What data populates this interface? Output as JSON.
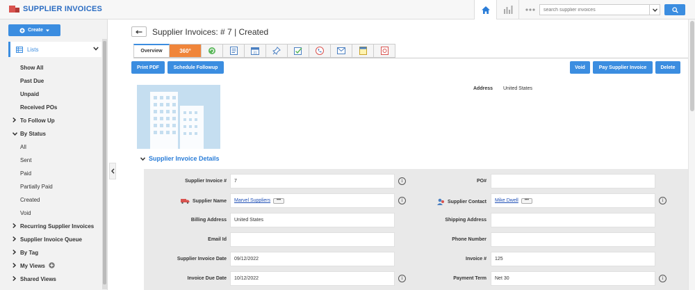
{
  "app": {
    "title": "SUPPLIER INVOICES"
  },
  "search": {
    "placeholder": "search supplier invoices"
  },
  "sidebar": {
    "create_label": "Create",
    "lists_label": "Lists",
    "items": [
      {
        "label": "Show All",
        "bold": true,
        "kind": "top"
      },
      {
        "label": "Past Due",
        "bold": true,
        "kind": "top"
      },
      {
        "label": "Unpaid",
        "bold": true,
        "kind": "top"
      },
      {
        "label": "Received POs",
        "bold": true,
        "kind": "top"
      },
      {
        "label": "To Follow Up",
        "bold": true,
        "kind": "collapsed"
      },
      {
        "label": "By Status",
        "bold": true,
        "kind": "expanded"
      },
      {
        "label": "All",
        "bold": false,
        "kind": "sub"
      },
      {
        "label": "Sent",
        "bold": false,
        "kind": "sub"
      },
      {
        "label": "Paid",
        "bold": false,
        "kind": "sub"
      },
      {
        "label": "Partially Paid",
        "bold": false,
        "kind": "sub"
      },
      {
        "label": "Created",
        "bold": false,
        "kind": "sub"
      },
      {
        "label": "Void",
        "bold": false,
        "kind": "sub"
      },
      {
        "label": "Recurring Supplier Invoices",
        "bold": true,
        "kind": "collapsed"
      },
      {
        "label": "Supplier Invoice Queue",
        "bold": true,
        "kind": "collapsed"
      },
      {
        "label": "By Tag",
        "bold": true,
        "kind": "collapsed"
      },
      {
        "label": "My Views",
        "bold": true,
        "kind": "collapsed-add"
      },
      {
        "label": "Shared Views",
        "bold": true,
        "kind": "collapsed"
      }
    ]
  },
  "page": {
    "title": "Supplier Invoices: # 7 | Created"
  },
  "tabs": {
    "overview": "Overview",
    "t360": "360°"
  },
  "actions": {
    "print_pdf": "Print PDF",
    "schedule_followup": "Schedule Followup",
    "void": "Void",
    "pay": "Pay Supplier Invoice",
    "delete": "Delete"
  },
  "address": {
    "label": "Address",
    "value": "United States"
  },
  "section": {
    "title": "Supplier Invoice Details"
  },
  "fields": {
    "supplier_invoice_no": {
      "label": "Supplier Invoice #",
      "value": "7"
    },
    "po_no": {
      "label": "PO#",
      "value": ""
    },
    "supplier_name": {
      "label": "Supplier Name",
      "value": "Marvel Suppliers"
    },
    "supplier_contact": {
      "label": "Supplier Contact",
      "value": "Mike Dwell"
    },
    "billing_address": {
      "label": "Billing Address",
      "value": "United States"
    },
    "shipping_address": {
      "label": "Shipping Address",
      "value": ""
    },
    "email_id": {
      "label": "Email Id",
      "value": ""
    },
    "phone_number": {
      "label": "Phone Number",
      "value": ""
    },
    "supplier_invoice_date": {
      "label": "Supplier Invoice Date",
      "value": "09/12/2022"
    },
    "invoice_no": {
      "label": "Invoice #",
      "value": "125"
    },
    "invoice_due_date": {
      "label": "Invoice Due Date",
      "value": "10/12/2022"
    },
    "payment_term": {
      "label": "Payment Term",
      "value": "Net 30"
    }
  }
}
